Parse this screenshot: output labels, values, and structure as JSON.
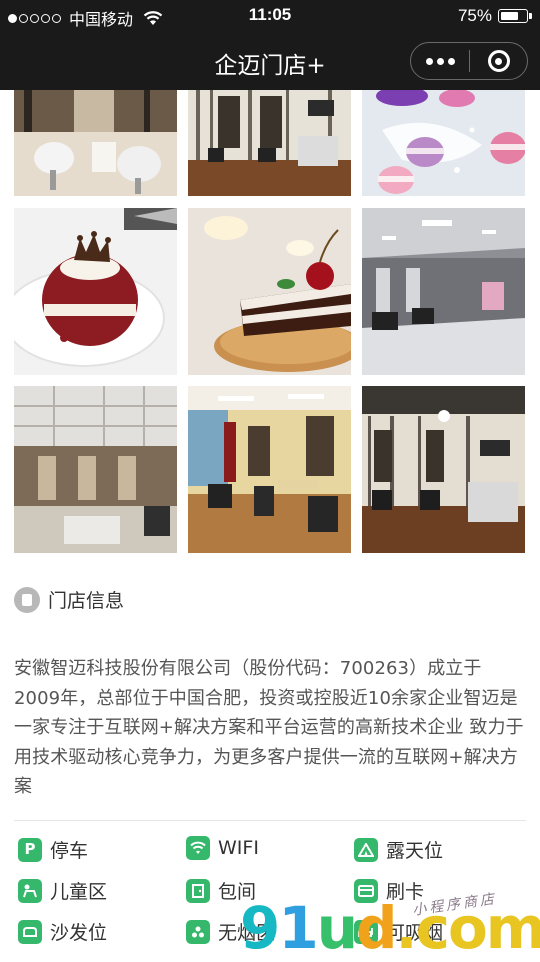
{
  "status_bar": {
    "carrier": "中国移动",
    "time": "11:05",
    "battery_text": "75%",
    "battery_level": 0.75,
    "signal_bars_filled": 1,
    "signal_bars_total": 5
  },
  "nav": {
    "title": "企迈门店+",
    "more_icon": "more-dots-icon",
    "close_icon": "circle-close-icon"
  },
  "gallery": {
    "photos": [
      {
        "name": "salon-white-chairs-photo"
      },
      {
        "name": "salon-birch-wallpaper-photo"
      },
      {
        "name": "macarons-photo"
      },
      {
        "name": "red-velvet-cake-photo"
      },
      {
        "name": "cherry-cake-slice-photo"
      },
      {
        "name": "salon-interior-grey-photo"
      },
      {
        "name": "salon-hall-photo"
      },
      {
        "name": "salon-yellow-wall-photo"
      },
      {
        "name": "salon-birch-mirror-photo"
      }
    ]
  },
  "store_info": {
    "section_title": "门店信息",
    "description": "安徽智迈科技股份有限公司（股份代码：700263）成立于2009年，总部位于中国合肥，投资或控股近10余家企业智迈是一家专注于互联网+解决方案和平台运营的高新技术企业 致力于用技术驱动核心竞争力，为更多客户提供一流的互联网+解决方案"
  },
  "facilities": [
    {
      "label": "停车",
      "icon": "parking-icon",
      "glyph": "P"
    },
    {
      "label": "WIFI",
      "icon": "wifi-icon",
      "glyph": ""
    },
    {
      "label": "露天位",
      "icon": "outdoor-seating-icon",
      "glyph": ""
    },
    {
      "label": "儿童区",
      "icon": "kids-area-icon",
      "glyph": ""
    },
    {
      "label": "包间",
      "icon": "private-room-icon",
      "glyph": ""
    },
    {
      "label": "刷卡",
      "icon": "card-payment-icon",
      "glyph": ""
    },
    {
      "label": "沙发位",
      "icon": "sofa-icon",
      "glyph": ""
    },
    {
      "label": "无烟区",
      "icon": "no-smoking-icon",
      "glyph": ""
    },
    {
      "label": "可吸烟",
      "icon": "smoking-icon",
      "glyph": ""
    }
  ],
  "watermark": {
    "brand": "91ud.com",
    "script": "小程序商店"
  },
  "colors": {
    "bar_bg": "#1a1a1a",
    "facility_green": "#35b86b",
    "section_icon_grey": "#b8b8b8"
  }
}
